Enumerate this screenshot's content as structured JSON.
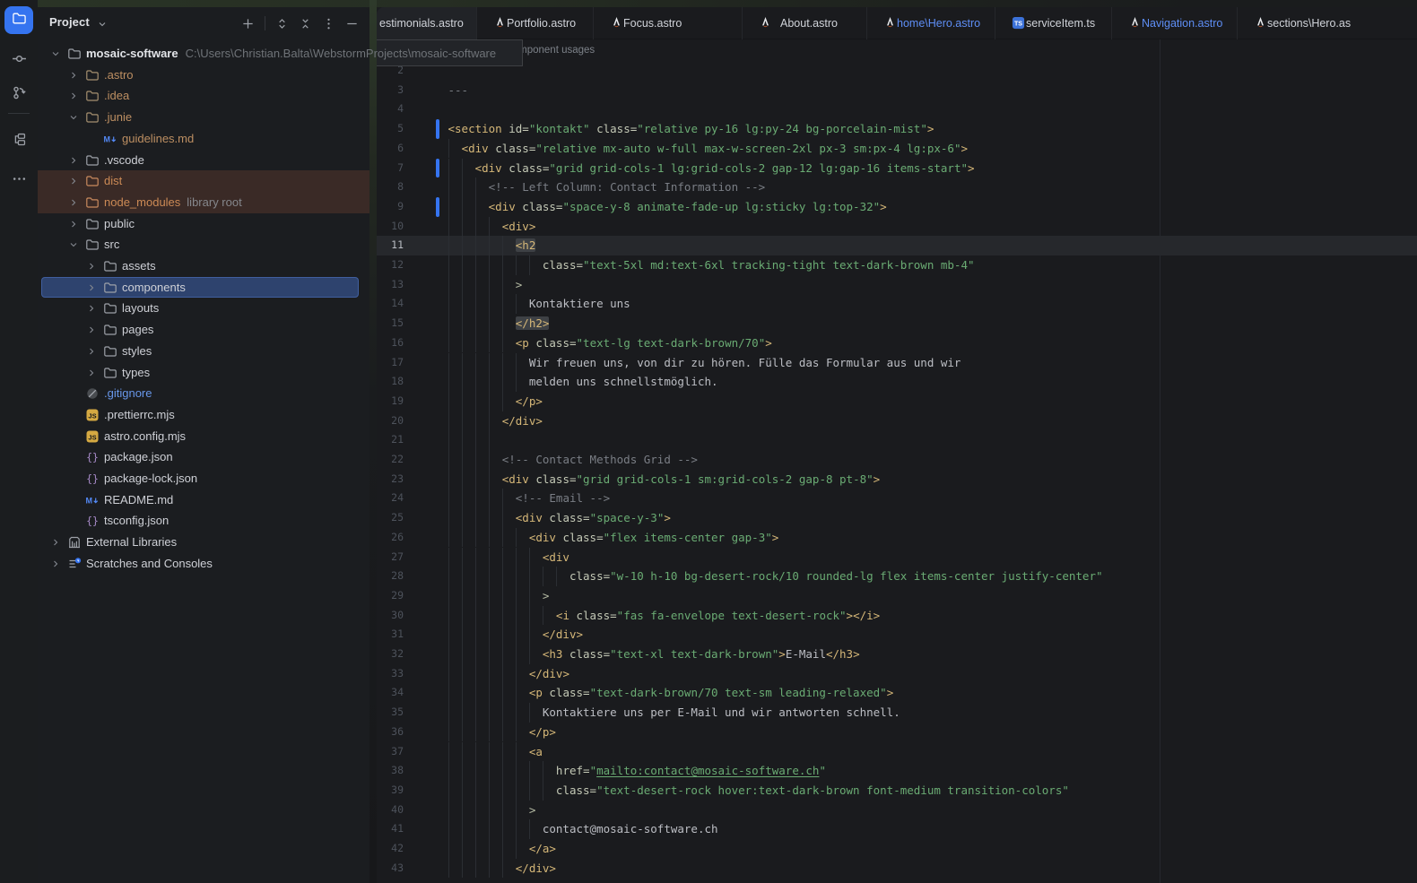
{
  "colors": {
    "accent_blue": "#3574f0",
    "selection_blue": "#2e436e",
    "modified_tab_blue": "#5e8ef5",
    "tag": "#d5b778",
    "string_green": "#6aab73",
    "comment_gray": "#7a7e85",
    "unversioned_tan": "#bd8f62",
    "excluded_orange": "#cc8a55",
    "excluded_row_bg": "#3a2a26",
    "ignored_blue": "#6897ea"
  },
  "activity_bar": {
    "items": [
      {
        "name": "project",
        "icon": "folder",
        "active": true
      },
      {
        "name": "commit",
        "icon": "commit",
        "active": false
      },
      {
        "name": "version-control",
        "icon": "vcs",
        "active": false
      },
      {
        "name": "structure",
        "icon": "structure",
        "active": false,
        "divider_before": true
      },
      {
        "name": "more-tool-windows",
        "icon": "more",
        "active": false
      }
    ]
  },
  "project_panel": {
    "title": "Project",
    "toolbar": [
      "plus",
      "divider",
      "unfold",
      "fold",
      "kebab",
      "minus"
    ],
    "tree": [
      {
        "label": "mosaic-software",
        "path": "C:\\Users\\Christian.Balta\\WebstormProjects\\mosaic-software",
        "level": 0,
        "chevron": "down",
        "icon": "folder",
        "status": "root"
      },
      {
        "label": ".astro",
        "level": 1,
        "chevron": "right",
        "icon": "folder",
        "status": "unversioned"
      },
      {
        "label": ".idea",
        "level": 1,
        "chevron": "right",
        "icon": "folder",
        "status": "unversioned"
      },
      {
        "label": ".junie",
        "level": 1,
        "chevron": "down",
        "icon": "folder",
        "status": "unversioned"
      },
      {
        "label": "guidelines.md",
        "level": 2,
        "chevron": "none",
        "icon": "md",
        "status": "unversioned"
      },
      {
        "label": ".vscode",
        "level": 1,
        "chevron": "right",
        "icon": "folder",
        "status": "normal"
      },
      {
        "label": "dist",
        "level": 1,
        "chevron": "right",
        "icon": "folder",
        "status": "excluded",
        "row_bg": true
      },
      {
        "label": "node_modules",
        "suffix": "library root",
        "level": 1,
        "chevron": "right",
        "icon": "folder",
        "status": "excluded",
        "row_bg": true
      },
      {
        "label": "public",
        "level": 1,
        "chevron": "right",
        "icon": "folder",
        "status": "normal"
      },
      {
        "label": "src",
        "level": 1,
        "chevron": "down",
        "icon": "folder",
        "status": "normal"
      },
      {
        "label": "assets",
        "level": 2,
        "chevron": "right",
        "icon": "folder",
        "status": "normal"
      },
      {
        "label": "components",
        "level": 2,
        "chevron": "right",
        "icon": "folder",
        "status": "normal",
        "selected": true
      },
      {
        "label": "layouts",
        "level": 2,
        "chevron": "right",
        "icon": "folder",
        "status": "normal"
      },
      {
        "label": "pages",
        "level": 2,
        "chevron": "right",
        "icon": "folder",
        "status": "normal"
      },
      {
        "label": "styles",
        "level": 2,
        "chevron": "right",
        "icon": "folder",
        "status": "normal"
      },
      {
        "label": "types",
        "level": 2,
        "chevron": "right",
        "icon": "folder",
        "status": "normal"
      },
      {
        "label": ".gitignore",
        "level": 1,
        "chevron": "none",
        "icon": "ignored",
        "status": "ignored"
      },
      {
        "label": ".prettierrc.mjs",
        "level": 1,
        "chevron": "none",
        "icon": "js",
        "status": "normal"
      },
      {
        "label": "astro.config.mjs",
        "level": 1,
        "chevron": "none",
        "icon": "js",
        "status": "normal"
      },
      {
        "label": "package.json",
        "level": 1,
        "chevron": "none",
        "icon": "json",
        "status": "normal"
      },
      {
        "label": "package-lock.json",
        "level": 1,
        "chevron": "none",
        "icon": "json",
        "status": "normal"
      },
      {
        "label": "README.md",
        "level": 1,
        "chevron": "none",
        "icon": "md",
        "status": "normal"
      },
      {
        "label": "tsconfig.json",
        "level": 1,
        "chevron": "none",
        "icon": "json",
        "status": "normal"
      },
      {
        "label": "External Libraries",
        "level": 0,
        "chevron": "right",
        "icon": "lib",
        "status": "normal"
      },
      {
        "label": "Scratches and Consoles",
        "level": 0,
        "chevron": "right",
        "icon": "scratch",
        "status": "normal"
      }
    ]
  },
  "tabs": [
    {
      "label": "estimonials.astro",
      "icon": null,
      "modified": false
    },
    {
      "label": "Portfolio.astro",
      "icon": "astro",
      "modified": false
    },
    {
      "label": "Focus.astro",
      "icon": "astro",
      "modified": false
    },
    {
      "label": "About.astro",
      "icon": "astro",
      "modified": false
    },
    {
      "label": "home\\Hero.astro",
      "icon": "astro",
      "modified": true
    },
    {
      "label": "serviceItem.ts",
      "icon": "ts",
      "modified": false
    },
    {
      "label": "Navigation.astro",
      "icon": "astro",
      "modified": true
    },
    {
      "label": "sections\\Hero.as",
      "icon": "astro",
      "modified": false
    }
  ],
  "editor": {
    "inlay_hint": "component usages",
    "current_line": 11,
    "vcs_changed_lines": [
      5,
      7,
      9
    ],
    "lines": [
      {
        "n": 2,
        "ind": 0,
        "segs": []
      },
      {
        "n": 3,
        "ind": 0,
        "segs": [
          [
            "c",
            "---"
          ]
        ]
      },
      {
        "n": 4,
        "ind": 0,
        "segs": []
      },
      {
        "n": 5,
        "ind": 0,
        "segs": [
          [
            "t",
            "<section"
          ],
          [
            "a",
            " id="
          ],
          [
            "s",
            "\"kontakt\""
          ],
          [
            "a",
            " class="
          ],
          [
            "s",
            "\"relative py-16 lg:py-24 bg-porcelain-mist\""
          ],
          [
            "t",
            ">"
          ]
        ]
      },
      {
        "n": 6,
        "ind": 2,
        "segs": [
          [
            "t",
            "<div"
          ],
          [
            "a",
            " class="
          ],
          [
            "s",
            "\"relative mx-auto w-full max-w-screen-2xl px-3 sm:px-4 lg:px-6\""
          ],
          [
            "t",
            ">"
          ]
        ]
      },
      {
        "n": 7,
        "ind": 4,
        "segs": [
          [
            "t",
            "<div"
          ],
          [
            "a",
            " class="
          ],
          [
            "s",
            "\"grid grid-cols-1 lg:grid-cols-2 gap-12 lg:gap-16 items-start\""
          ],
          [
            "t",
            ">"
          ]
        ]
      },
      {
        "n": 8,
        "ind": 6,
        "segs": [
          [
            "c",
            "<!-- Left Column: Contact Information -->"
          ]
        ]
      },
      {
        "n": 9,
        "ind": 6,
        "segs": [
          [
            "t",
            "<div"
          ],
          [
            "a",
            " class="
          ],
          [
            "s",
            "\"space-y-8 animate-fade-up lg:sticky lg:top-32\""
          ],
          [
            "t",
            ">"
          ]
        ]
      },
      {
        "n": 10,
        "ind": 8,
        "segs": [
          [
            "t",
            "<div>"
          ]
        ]
      },
      {
        "n": 11,
        "ind": 10,
        "segs": [
          [
            "m",
            "<h2"
          ]
        ]
      },
      {
        "n": 12,
        "ind": 14,
        "segs": [
          [
            "a",
            "class="
          ],
          [
            "s",
            "\"text-5xl md:text-6xl tracking-tight text-dark-brown mb-4\""
          ]
        ]
      },
      {
        "n": 13,
        "ind": 10,
        "segs": [
          [
            "p",
            ">"
          ]
        ]
      },
      {
        "n": 14,
        "ind": 12,
        "segs": [
          [
            "x",
            "Kontaktiere uns"
          ]
        ]
      },
      {
        "n": 15,
        "ind": 10,
        "segs": [
          [
            "m",
            "</h2>"
          ]
        ]
      },
      {
        "n": 16,
        "ind": 10,
        "segs": [
          [
            "t",
            "<p"
          ],
          [
            "a",
            " class="
          ],
          [
            "s",
            "\"text-lg text-dark-brown/70\""
          ],
          [
            "t",
            ">"
          ]
        ]
      },
      {
        "n": 17,
        "ind": 12,
        "segs": [
          [
            "x",
            "Wir freuen uns, von dir zu hören. Fülle das Formular aus und wir"
          ]
        ]
      },
      {
        "n": 18,
        "ind": 12,
        "segs": [
          [
            "x",
            "melden uns schnellstmöglich."
          ]
        ]
      },
      {
        "n": 19,
        "ind": 10,
        "segs": [
          [
            "t",
            "</p>"
          ]
        ]
      },
      {
        "n": 20,
        "ind": 8,
        "segs": [
          [
            "t",
            "</div>"
          ]
        ]
      },
      {
        "n": 21,
        "ind": 8,
        "segs": []
      },
      {
        "n": 22,
        "ind": 8,
        "segs": [
          [
            "c",
            "<!-- Contact Methods Grid -->"
          ]
        ]
      },
      {
        "n": 23,
        "ind": 8,
        "segs": [
          [
            "t",
            "<div"
          ],
          [
            "a",
            " class="
          ],
          [
            "s",
            "\"grid grid-cols-1 sm:grid-cols-2 gap-8 pt-8\""
          ],
          [
            "t",
            ">"
          ]
        ]
      },
      {
        "n": 24,
        "ind": 10,
        "segs": [
          [
            "c",
            "<!-- Email -->"
          ]
        ]
      },
      {
        "n": 25,
        "ind": 10,
        "segs": [
          [
            "t",
            "<div"
          ],
          [
            "a",
            " class="
          ],
          [
            "s",
            "\"space-y-3\""
          ],
          [
            "t",
            ">"
          ]
        ]
      },
      {
        "n": 26,
        "ind": 12,
        "segs": [
          [
            "t",
            "<div"
          ],
          [
            "a",
            " class="
          ],
          [
            "s",
            "\"flex items-center gap-3\""
          ],
          [
            "t",
            ">"
          ]
        ]
      },
      {
        "n": 27,
        "ind": 14,
        "segs": [
          [
            "t",
            "<div"
          ]
        ]
      },
      {
        "n": 28,
        "ind": 18,
        "segs": [
          [
            "a",
            "class="
          ],
          [
            "s",
            "\"w-10 h-10 bg-desert-rock/10 rounded-lg flex items-center justify-center\""
          ]
        ]
      },
      {
        "n": 29,
        "ind": 14,
        "segs": [
          [
            "p",
            ">"
          ]
        ]
      },
      {
        "n": 30,
        "ind": 16,
        "segs": [
          [
            "t",
            "<i"
          ],
          [
            "a",
            " class="
          ],
          [
            "s",
            "\"fas fa-envelope text-desert-rock\""
          ],
          [
            "t",
            "></i>"
          ]
        ]
      },
      {
        "n": 31,
        "ind": 14,
        "segs": [
          [
            "t",
            "</div>"
          ]
        ]
      },
      {
        "n": 32,
        "ind": 14,
        "segs": [
          [
            "t",
            "<h3"
          ],
          [
            "a",
            " class="
          ],
          [
            "s",
            "\"text-xl text-dark-brown\""
          ],
          [
            "t",
            ">"
          ],
          [
            "x",
            "E-Mail"
          ],
          [
            "t",
            "</h3>"
          ]
        ]
      },
      {
        "n": 33,
        "ind": 12,
        "segs": [
          [
            "t",
            "</div>"
          ]
        ]
      },
      {
        "n": 34,
        "ind": 12,
        "segs": [
          [
            "t",
            "<p"
          ],
          [
            "a",
            " class="
          ],
          [
            "s",
            "\"text-dark-brown/70 text-sm leading-relaxed\""
          ],
          [
            "t",
            ">"
          ]
        ]
      },
      {
        "n": 35,
        "ind": 14,
        "segs": [
          [
            "x",
            "Kontaktiere uns per E-Mail und wir antworten schnell."
          ]
        ]
      },
      {
        "n": 36,
        "ind": 12,
        "segs": [
          [
            "t",
            "</p>"
          ]
        ]
      },
      {
        "n": 37,
        "ind": 12,
        "segs": [
          [
            "t",
            "<a"
          ]
        ]
      },
      {
        "n": 38,
        "ind": 16,
        "segs": [
          [
            "a",
            "href="
          ],
          [
            "s",
            "\""
          ],
          [
            "l",
            "mailto:contact@mosaic-software.ch"
          ],
          [
            "s",
            "\""
          ]
        ]
      },
      {
        "n": 39,
        "ind": 16,
        "segs": [
          [
            "a",
            "class="
          ],
          [
            "s",
            "\"text-desert-rock hover:text-dark-brown font-medium transition-colors\""
          ]
        ]
      },
      {
        "n": 40,
        "ind": 12,
        "segs": [
          [
            "p",
            ">"
          ]
        ]
      },
      {
        "n": 41,
        "ind": 14,
        "segs": [
          [
            "x",
            "contact@mosaic-software.ch"
          ]
        ]
      },
      {
        "n": 42,
        "ind": 12,
        "segs": [
          [
            "t",
            "</a>"
          ]
        ]
      },
      {
        "n": 43,
        "ind": 10,
        "segs": [
          [
            "t",
            "</div>"
          ]
        ]
      }
    ]
  }
}
